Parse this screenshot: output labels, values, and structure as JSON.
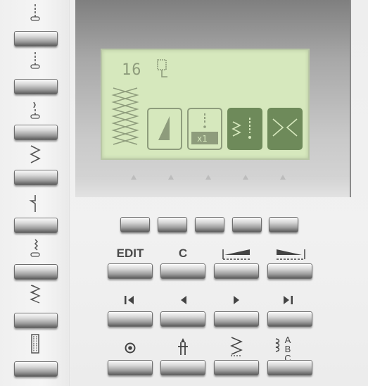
{
  "display": {
    "stitch_number": "16",
    "tabs": [
      "tab-tapering",
      "tab-repeat-x1",
      "tab-stitch-mirror-mark",
      "tab-mirror-x"
    ]
  },
  "edit_row": {
    "edit_label": "EDIT",
    "clear_label": "C"
  },
  "lettering": {
    "abc_label": "ABC"
  },
  "colors": {
    "lcd_background": "#d6e8bd",
    "lcd_ink": "#8e9c7c",
    "lcd_active": "#6e8a5a",
    "button_dark": "#5d5d5d"
  },
  "icons": {
    "left_column": [
      "straight-stitch-left-needle-icon",
      "straight-stitch-center-needle-icon",
      "stretch-straight-stitch-icon",
      "zigzag-stitch-icon",
      "blind-hem-stitch-icon",
      "bartack-stitch-icon",
      "triple-zigzag-stitch-icon",
      "buttonhole-icon"
    ]
  }
}
